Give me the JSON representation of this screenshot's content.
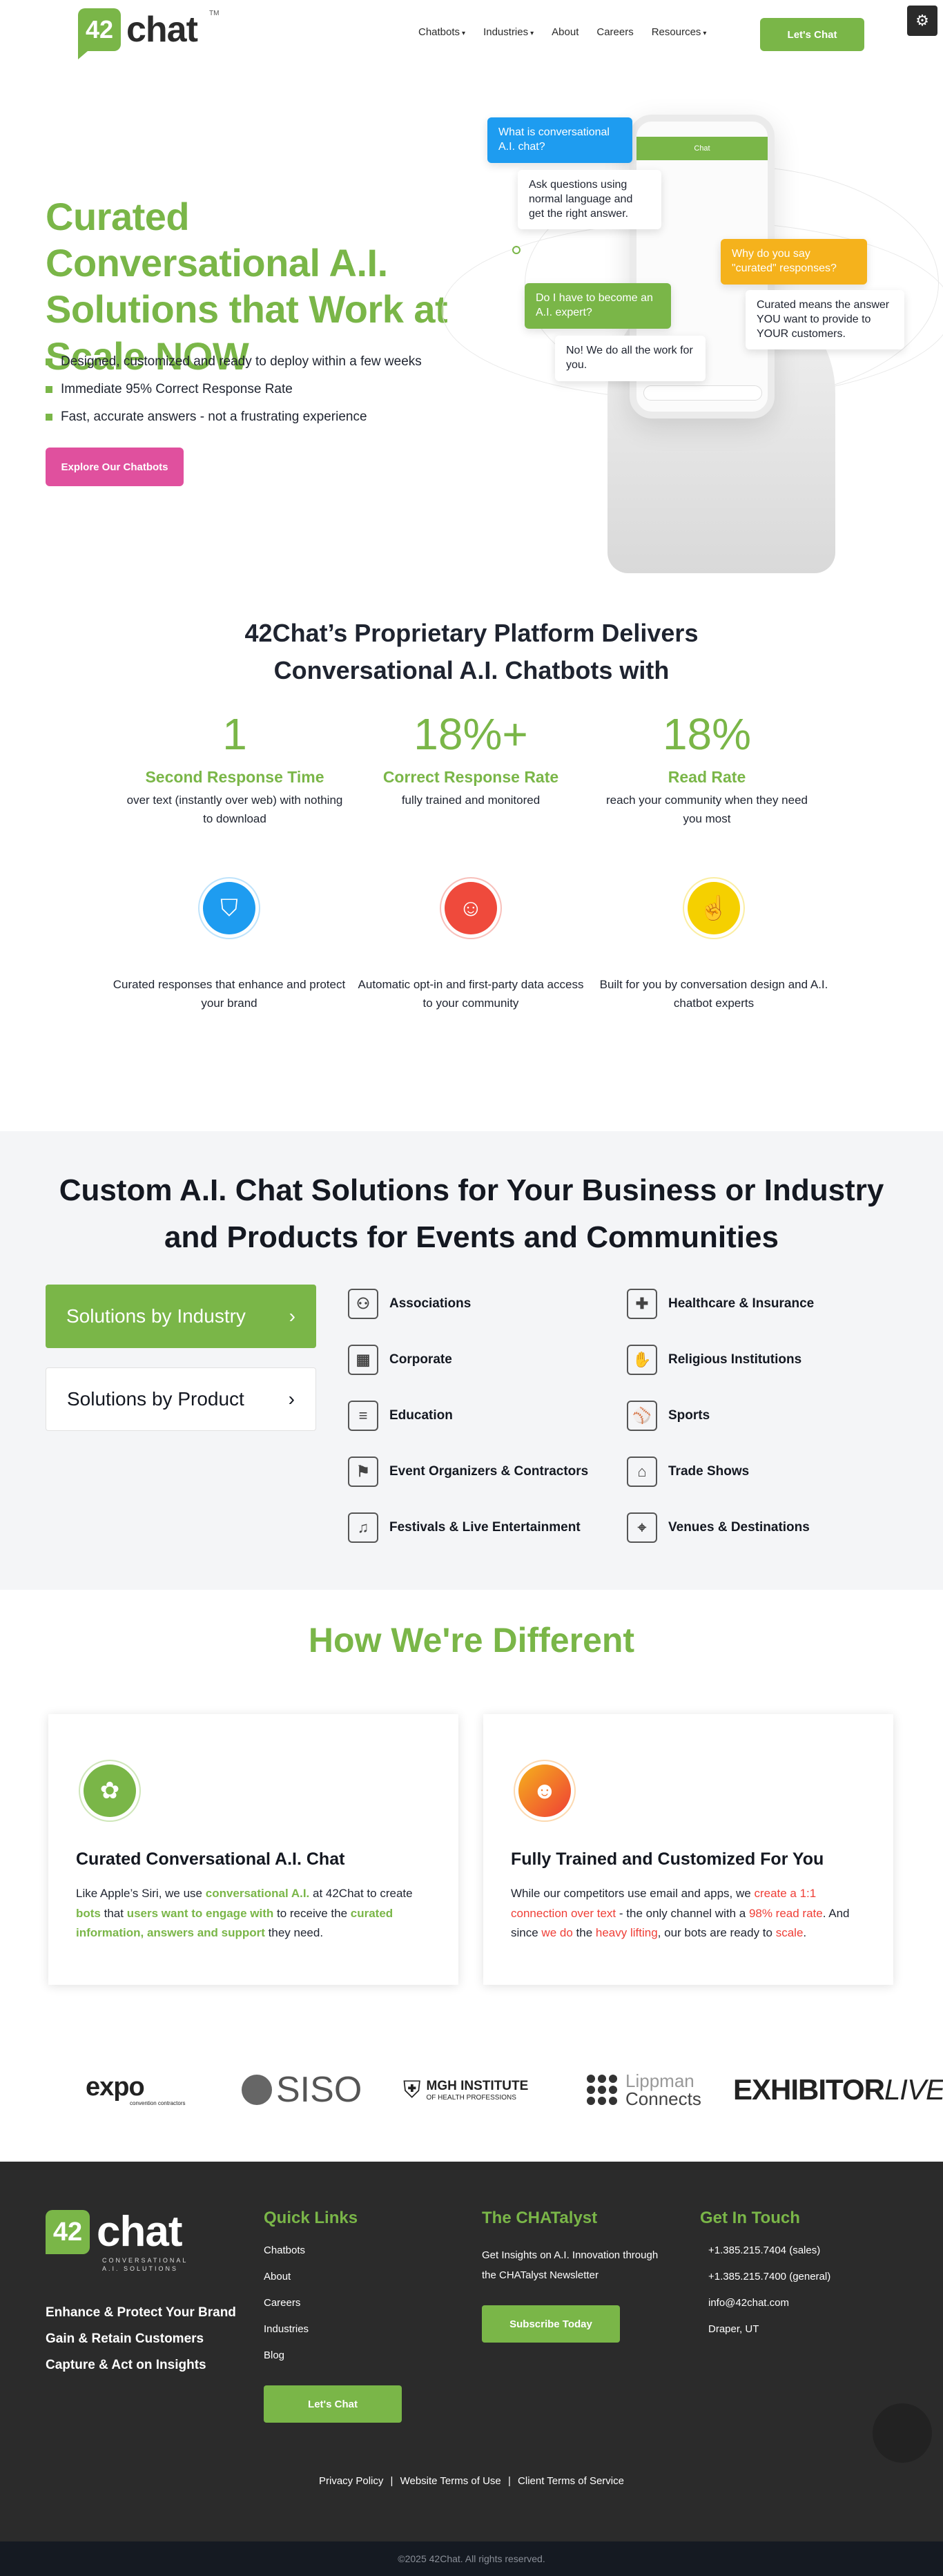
{
  "header": {
    "logo_num": "42",
    "logo_word": "chat",
    "logo_tm": "TM",
    "nav": [
      {
        "label": "Chatbots",
        "has_chevron": true
      },
      {
        "label": "Industries",
        "has_chevron": true
      },
      {
        "label": "About",
        "has_chevron": false
      },
      {
        "label": "Careers",
        "has_chevron": false
      },
      {
        "label": "Resources",
        "has_chevron": true
      }
    ],
    "cta": "Let's Chat"
  },
  "hero": {
    "title": "Curated Conversational A.I. Solutions that Work at Scale NOW",
    "bullets": [
      "Designed, customized and ready to deploy within a few weeks",
      "Immediate 95% Correct Response Rate",
      "Fast, accurate answers -  not a frustrating experience"
    ],
    "button": "Explore Our Chatbots",
    "phone_header": "Chat",
    "bubbles": {
      "q1": "What is conversational A.I. chat?",
      "a1": "Ask questions using normal language and get the right answer.",
      "q2": "Why do you say \"curated\" responses?",
      "a2": "Curated means the answer YOU want to provide to YOUR customers.",
      "q3": "Do I have to become an A.I. expert?",
      "a3": "No! We do all the work for you."
    }
  },
  "stats": {
    "title_line1": "42Chat’s Proprietary Platform Delivers",
    "title_line2": "Conversational A.I. Chatbots with",
    "items": [
      {
        "number": "1",
        "label": "Second Response Time",
        "desc": "over text (instantly over web) with nothing to download"
      },
      {
        "number": "18%+",
        "label": "Correct Response Rate",
        "desc": "fully trained and monitored"
      },
      {
        "number": "18%",
        "label": "Read Rate",
        "desc": "reach your community when they need you most"
      }
    ],
    "features": [
      {
        "icon": "shield-hand-icon",
        "color": "#1e9cf0",
        "desc": "Curated responses that enhance and protect your brand"
      },
      {
        "icon": "community-icon",
        "color": "#ef4a3c",
        "desc": "Automatic opt-in and first-party data access to your community"
      },
      {
        "icon": "design-touch-icon",
        "color": "#f5d000",
        "desc": "Built for you by conversation design and A.I. chatbot experts"
      }
    ]
  },
  "solutions": {
    "title_line1": "Custom A.I. Chat Solutions for Your Business or Industry",
    "title_line2": "and Products for Events and Communities",
    "tab_active": "Solutions by Industry",
    "tab_inactive": "Solutions by Product",
    "industries_left": [
      {
        "label": "Associations",
        "icon": "people-group-icon"
      },
      {
        "label": "Corporate",
        "icon": "building-icon"
      },
      {
        "label": "Education",
        "icon": "books-icon"
      },
      {
        "label": "Event Organizers & Contractors",
        "icon": "event-sign-icon"
      },
      {
        "label": "Festivals & Live Entertainment",
        "icon": "stage-icon"
      }
    ],
    "industries_right": [
      {
        "label": "Healthcare & Insurance",
        "icon": "hospital-icon"
      },
      {
        "label": "Religious Institutions",
        "icon": "hands-icon"
      },
      {
        "label": "Sports",
        "icon": "sports-ball-icon"
      },
      {
        "label": "Trade Shows",
        "icon": "booth-icon"
      },
      {
        "label": "Venues & Destinations",
        "icon": "map-pin-icon"
      }
    ]
  },
  "different": {
    "title": "How We're Different",
    "card1": {
      "title": "Curated Conversational A.I. Chat",
      "t1": "Like Apple’s Siri, we use ",
      "h1": "conversational A.I.",
      "t2": " at 42Chat to create ",
      "h2": "bots",
      "t3": " that ",
      "h3": "users want to engage with",
      "t4": " to receive the ",
      "h4": "curated information, answers and support",
      "t5": " they need."
    },
    "card2": {
      "title": "Fully Trained and Customized For You",
      "t1": "While our competitors use email and apps, we ",
      "h1": "create a 1:1 connection over text",
      "t2": " - the only channel with a ",
      "h2": "98% read rate",
      "t3": ". And since ",
      "h3": "we do",
      "t4": " the ",
      "h4": "heavy lifting",
      "t5": ", our bots are ready to ",
      "h5": "scale",
      "t6": "."
    }
  },
  "logos": {
    "items": [
      "expo",
      "SISO",
      "MGH INSTITUTE",
      "Lippman Connects",
      "EXHIBITORLIVE"
    ],
    "expo_sub": "convention contractors",
    "mgh_sub": "OF HEALTH PROFESSIONS",
    "lippman_word1": "Lippman",
    "lippman_word2": "Connects",
    "exhibitor_a": "EXHIBITOR",
    "exhibitor_b": "LIVE"
  },
  "footer": {
    "logo_num": "42",
    "logo_word": "chat",
    "logo_sub1": "CONVERSATIONAL",
    "logo_sub2": "A.I. SOLUTIONS",
    "taglines": [
      "Enhance & Protect Your Brand",
      "Gain & Retain Customers",
      "Capture & Act on Insights"
    ],
    "quick_links_title": "Quick Links",
    "quick_links": [
      "Chatbots",
      "About",
      "Careers",
      "Industries",
      "Blog"
    ],
    "quick_btn": "Let's Chat",
    "chatalyst_title": "The CHATalyst",
    "chatalyst_text": "Get Insights on A.I. Innovation through the CHATalyst Newsletter",
    "subscribe_btn": "Subscribe Today",
    "contact_title": "Get In Touch",
    "contacts": [
      "+1.385.215.7404 (sales)",
      "+1.385.215.7400 (general)",
      "info@42chat.com",
      "Draper, UT"
    ],
    "legal": [
      "Privacy Policy",
      "Website Terms of Use",
      "Client Terms of Service"
    ],
    "legal_sep": "|",
    "copyright": "©2025 42Chat. All rights reserved."
  },
  "colors": {
    "brand_green": "#7ab648",
    "pink": "#e0509e",
    "blue": "#1e9cf0",
    "yellow": "#f5b21c",
    "red": "#ef3e36",
    "footer_bg": "#2b2b2b"
  }
}
